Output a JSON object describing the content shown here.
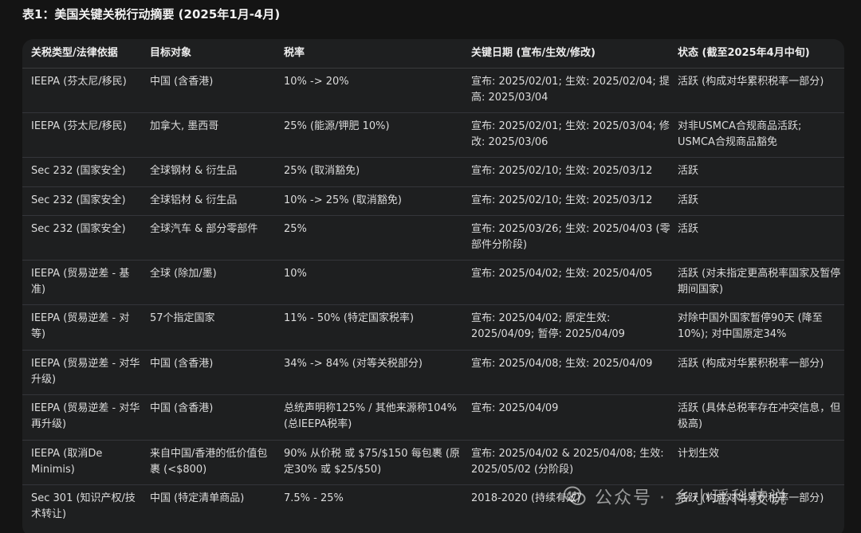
{
  "caption": "表1：美国关键关税行动摘要 (2025年1月-4月)",
  "headers": [
    "关税类型/法律依据",
    "目标对象",
    "税率",
    "关键日期 (宣布/生效/修改)",
    "状态 (截至2025年4月中旬)"
  ],
  "rows": [
    [
      "IEEPA (芬太尼/移民)",
      "中国 (含香港)",
      "10% -> 20%",
      "宣布: 2025/02/01; 生效: 2025/02/04; 提高: 2025/03/04",
      "活跃 (构成对华累积税率一部分)"
    ],
    [
      "IEEPA (芬太尼/移民)",
      "加拿大, 墨西哥",
      "25% (能源/钾肥 10%)",
      "宣布: 2025/02/01; 生效: 2025/03/04; 修改: 2025/03/06",
      "对非USMCA合规商品活跃; USMCA合规商品豁免"
    ],
    [
      "Sec 232 (国家安全)",
      "全球钢材 & 衍生品",
      "25% (取消豁免)",
      "宣布: 2025/02/10; 生效: 2025/03/12",
      "活跃"
    ],
    [
      "Sec 232 (国家安全)",
      "全球铝材 & 衍生品",
      "10% -> 25% (取消豁免)",
      "宣布: 2025/02/10; 生效: 2025/03/12",
      "活跃"
    ],
    [
      "Sec 232 (国家安全)",
      "全球汽车 & 部分零部件",
      "25%",
      "宣布: 2025/03/26; 生效: 2025/04/03 (零部件分阶段)",
      "活跃"
    ],
    [
      "IEEPA (贸易逆差 - 基准)",
      "全球 (除加/墨)",
      "10%",
      "宣布: 2025/04/02; 生效: 2025/04/05",
      "活跃 (对未指定更高税率国家及暂停期间国家)"
    ],
    [
      "IEEPA (贸易逆差 - 对等)",
      "57个指定国家",
      "11% - 50% (特定国家税率)",
      "宣布: 2025/04/02; 原定生效: 2025/04/09; 暂停: 2025/04/09",
      "对除中国外国家暂停90天 (降至10%); 对中国原定34%"
    ],
    [
      "IEEPA (贸易逆差 - 对华升级)",
      "中国 (含香港)",
      "34% -> 84% (对等关税部分)",
      "宣布: 2025/04/08; 生效: 2025/04/09",
      "活跃 (构成对华累积税率一部分)"
    ],
    [
      "IEEPA (贸易逆差 - 对华再升级)",
      "中国 (含香港)",
      "总统声明称125% / 其他来源称104% (总IEEPA税率)",
      "宣布: 2025/04/09",
      "活跃 (具体总税率存在冲突信息，但极高)"
    ],
    [
      "IEEPA (取消De Minimis)",
      "来自中国/香港的低价值包裹 (<$800)",
      "90% 从价税 或 $75/$150 每包裹 (原定30% 或 $25/$50)",
      "宣布: 2025/04/02 & 2025/04/08; 生效: 2025/05/02 (分阶段)",
      "计划生效"
    ],
    [
      "Sec 301 (知识产权/技术转让)",
      "中国 (特定清单商品)",
      "7.5% - 25%",
      "2018-2020 (持续有效)",
      "活跃 (构成对华累积税率一部分)"
    ]
  ],
  "watermark": "公众号 · 乡小瑶科技说",
  "watermark_icon": "wechat-icon"
}
